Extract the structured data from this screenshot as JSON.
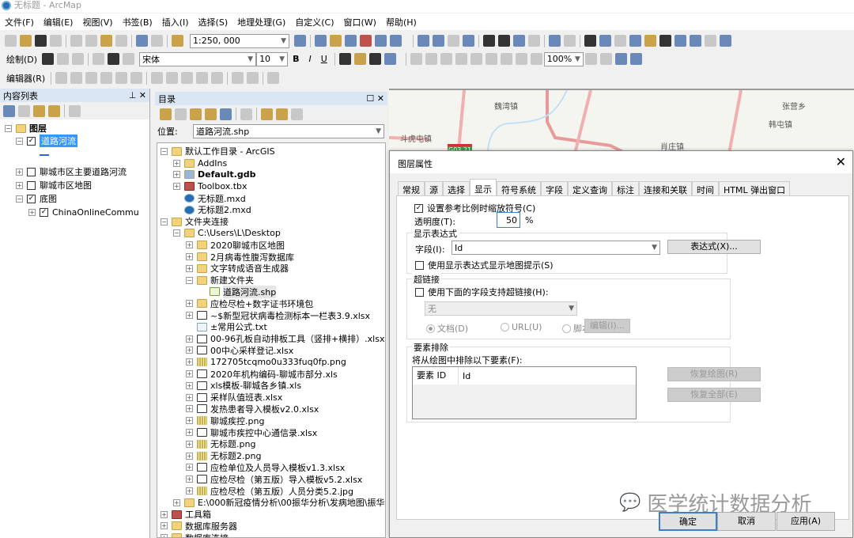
{
  "window": {
    "title": "无标题 - ArcMap"
  },
  "menu": [
    "文件(F)",
    "编辑(E)",
    "视图(V)",
    "书签(B)",
    "插入(I)",
    "选择(S)",
    "地理处理(G)",
    "自定义(C)",
    "窗口(W)",
    "帮助(H)"
  ],
  "toolbar": {
    "scale": "1:250, 000",
    "draw_label": "绘制(D)",
    "font": "宋体",
    "font_size": "10",
    "bold": "B",
    "italic": "I",
    "underline": "U",
    "zoom_percent": "100%",
    "editor_label": "编辑器(R)"
  },
  "toc": {
    "title": "内容列表",
    "root": "图层",
    "layers": [
      {
        "label": "道路河流",
        "checked": true,
        "expanded": true,
        "selected": true
      },
      {
        "label": "聊城市区主要道路河流",
        "checked": false
      },
      {
        "label": "聊城市区地图",
        "checked": false
      },
      {
        "label": "底图",
        "checked": true,
        "expanded": true
      },
      {
        "label": "ChinaOnlineCommu",
        "checked": true,
        "child": true
      }
    ]
  },
  "catalog": {
    "title": "目录",
    "location_label": "位置:",
    "location_value": "道路河流.shp",
    "items": [
      {
        "label": "默认工作目录 - ArcGIS",
        "level": 0,
        "pm": "-",
        "icon": "folder"
      },
      {
        "label": "AddIns",
        "level": 1,
        "pm": "+",
        "icon": "folder"
      },
      {
        "label": "Default.gdb",
        "level": 1,
        "pm": "+",
        "icon": "gdb",
        "bold": true
      },
      {
        "label": "Toolbox.tbx",
        "level": 1,
        "pm": "+",
        "icon": "toolbox"
      },
      {
        "label": "无标题.mxd",
        "level": 1,
        "pm": "",
        "icon": "mxd"
      },
      {
        "label": "无标题2.mxd",
        "level": 1,
        "pm": "",
        "icon": "mxd"
      },
      {
        "label": "文件夹连接",
        "level": 0,
        "pm": "-",
        "icon": "folder"
      },
      {
        "label": "C:\\Users\\L\\Desktop",
        "level": 1,
        "pm": "-",
        "icon": "folder"
      },
      {
        "label": "2020聊城市区地图",
        "level": 2,
        "pm": "+",
        "icon": "folder"
      },
      {
        "label": "2月病毒性腹泻数据库",
        "level": 2,
        "pm": "+",
        "icon": "folder"
      },
      {
        "label": "文字转成语音生成器",
        "level": 2,
        "pm": "+",
        "icon": "folder"
      },
      {
        "label": "新建文件夹",
        "level": 2,
        "pm": "-",
        "icon": "folder"
      },
      {
        "label": "道路河流.shp",
        "level": 3,
        "pm": "",
        "icon": "shp"
      },
      {
        "label": "应检尽检+数字证书环境包",
        "level": 2,
        "pm": "+",
        "icon": "folder"
      },
      {
        "label": "~$新型冠状病毒检测标本一栏表3.9.xlsx",
        "level": 2,
        "pm": "+",
        "icon": "xls"
      },
      {
        "label": "±常用公式.txt",
        "level": 2,
        "pm": "",
        "icon": "txt"
      },
      {
        "label": "00-96孔板自动排板工具（竖排+横排）.xlsx",
        "level": 2,
        "pm": "+",
        "icon": "xls"
      },
      {
        "label": "00中心采样登记.xlsx",
        "level": 2,
        "pm": "+",
        "icon": "xls"
      },
      {
        "label": "172705tcqmo0u333fuq0fp.png",
        "level": 2,
        "pm": "+",
        "icon": "img"
      },
      {
        "label": "2020年机构编码-聊城市部分.xls",
        "level": 2,
        "pm": "+",
        "icon": "xls"
      },
      {
        "label": "xls模板-聊城各乡镇.xls",
        "level": 2,
        "pm": "+",
        "icon": "xls"
      },
      {
        "label": "采样队值班表.xlsx",
        "level": 2,
        "pm": "+",
        "icon": "xls"
      },
      {
        "label": "发热患者导入模板v2.0.xlsx",
        "level": 2,
        "pm": "+",
        "icon": "xls"
      },
      {
        "label": "聊城疾控.png",
        "level": 2,
        "pm": "+",
        "icon": "img"
      },
      {
        "label": "聊城市疾控中心通信录.xlsx",
        "level": 2,
        "pm": "+",
        "icon": "xls"
      },
      {
        "label": "无标题.png",
        "level": 2,
        "pm": "+",
        "icon": "img"
      },
      {
        "label": "无标题2.png",
        "level": 2,
        "pm": "+",
        "icon": "img"
      },
      {
        "label": "应检单位及人员导入模板v1.3.xlsx",
        "level": 2,
        "pm": "+",
        "icon": "xls"
      },
      {
        "label": "应检尽检（第五版）导入模板v5.2.xlsx",
        "level": 2,
        "pm": "+",
        "icon": "xls"
      },
      {
        "label": "应检尽检（第五版）人员分类5.2.jpg",
        "level": 2,
        "pm": "+",
        "icon": "img"
      },
      {
        "label": "E:\\000新冠疫情分析\\00振华分析\\发病地图\\振华相",
        "level": 1,
        "pm": "+",
        "icon": "folder"
      },
      {
        "label": "工具箱",
        "level": 0,
        "pm": "+",
        "icon": "toolbox"
      },
      {
        "label": "数据库服务器",
        "level": 0,
        "pm": "+",
        "icon": "folder"
      },
      {
        "label": "数据库连接",
        "level": 0,
        "pm": "+",
        "icon": "folder"
      }
    ]
  },
  "map": {
    "labels": [
      "魏湾镇",
      "张营乡",
      "韩屯镇",
      "斗虎屯镇",
      "肖庄镇"
    ],
    "shield": "G03 21"
  },
  "dialog": {
    "title": "图层属性",
    "tabs": [
      "常规",
      "源",
      "选择",
      "显示",
      "符号系统",
      "字段",
      "定义查询",
      "标注",
      "连接和关联",
      "时间",
      "HTML 弹出窗口"
    ],
    "active_tab": "显示",
    "scale_symbols": "设置参考比例时缩放符号(C)",
    "scale_symbols_checked": true,
    "transparency_label": "透明度(T):",
    "transparency_value": "50",
    "percent": "%",
    "display_expr": {
      "group": "显示表达式",
      "field_label": "字段(I):",
      "field_value": "Id",
      "expr_button": "表达式(X)...",
      "maptip": "使用显示表达式显示地图提示(S)"
    },
    "hyperlink": {
      "group": "超链接",
      "checkbox": "使用下面的字段支持超链接(H):",
      "field_value": "无",
      "radio_doc": "文档(D)",
      "radio_url": "URL(U)",
      "radio_script": "脚本(C)",
      "edit_button": "编辑(I)..."
    },
    "exclusion": {
      "group": "要素排除",
      "label": "将从绘图中排除以下要素(F):",
      "columns": [
        "要素 ID",
        "Id"
      ],
      "restore_button": "恢复绘图(R)",
      "restore_all_button": "恢复全部(E)"
    },
    "ok": "确定",
    "cancel": "取消",
    "apply": "应用(A)"
  },
  "watermark": "医学统计数据分析"
}
